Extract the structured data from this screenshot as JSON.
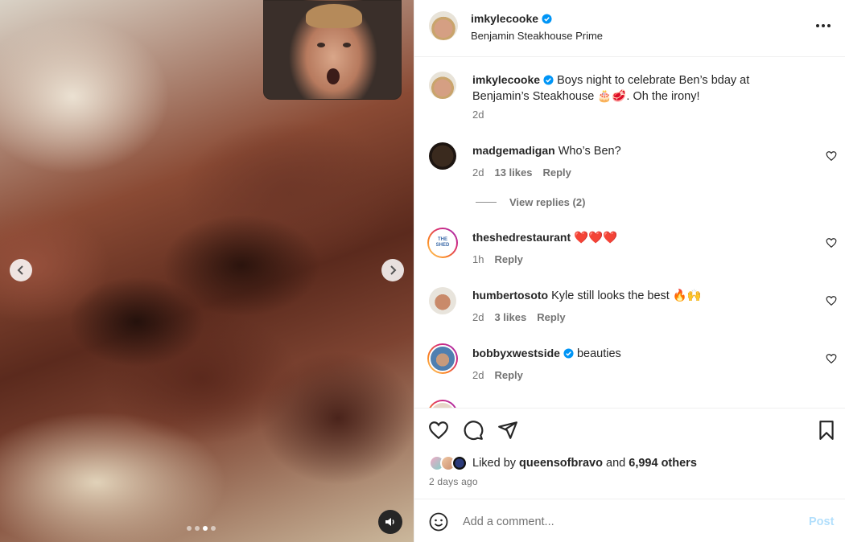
{
  "post": {
    "username": "imkylecooke",
    "location": "Benjamin Steakhouse Prime",
    "verified": true,
    "caption": "Boys night to celebrate Ben’s bday at Benjamin’s Steakhouse 🎂🥩. Oh the irony!",
    "caption_time": "2d"
  },
  "media": {
    "carousel_dots": 4,
    "active_dot": 2,
    "icons": [
      "chevron-left-icon",
      "chevron-right-icon",
      "speaker-icon"
    ]
  },
  "comments": [
    {
      "username": "madgemadigan",
      "text": "Who’s Ben?",
      "time": "2d",
      "likes": "13 likes",
      "reply": "Reply",
      "view_replies": "View replies (2)"
    },
    {
      "username": "theshedrestaurant",
      "text": "❤️❤️❤️",
      "time": "1h",
      "likes": "",
      "reply": "Reply",
      "avatar_text": "THE SHED"
    },
    {
      "username": "humbertosoto",
      "text": "Kyle still looks the best 🔥🙌",
      "time": "2d",
      "likes": "3 likes",
      "reply": "Reply"
    },
    {
      "username": "bobbyxwestside",
      "verified": true,
      "text": "beauties",
      "time": "2d",
      "likes": "",
      "reply": "Reply"
    }
  ],
  "likes": {
    "prefix": "Liked by",
    "user": "queensofbravo",
    "conjunction": "and",
    "others": "6,994 others",
    "time_ago": "2 days ago"
  },
  "add_comment": {
    "placeholder": "Add a comment...",
    "post_label": "Post"
  },
  "colors": {
    "verified": "#0095f6",
    "post_disabled": "#b2dffc",
    "secondary_text": "#737373"
  }
}
